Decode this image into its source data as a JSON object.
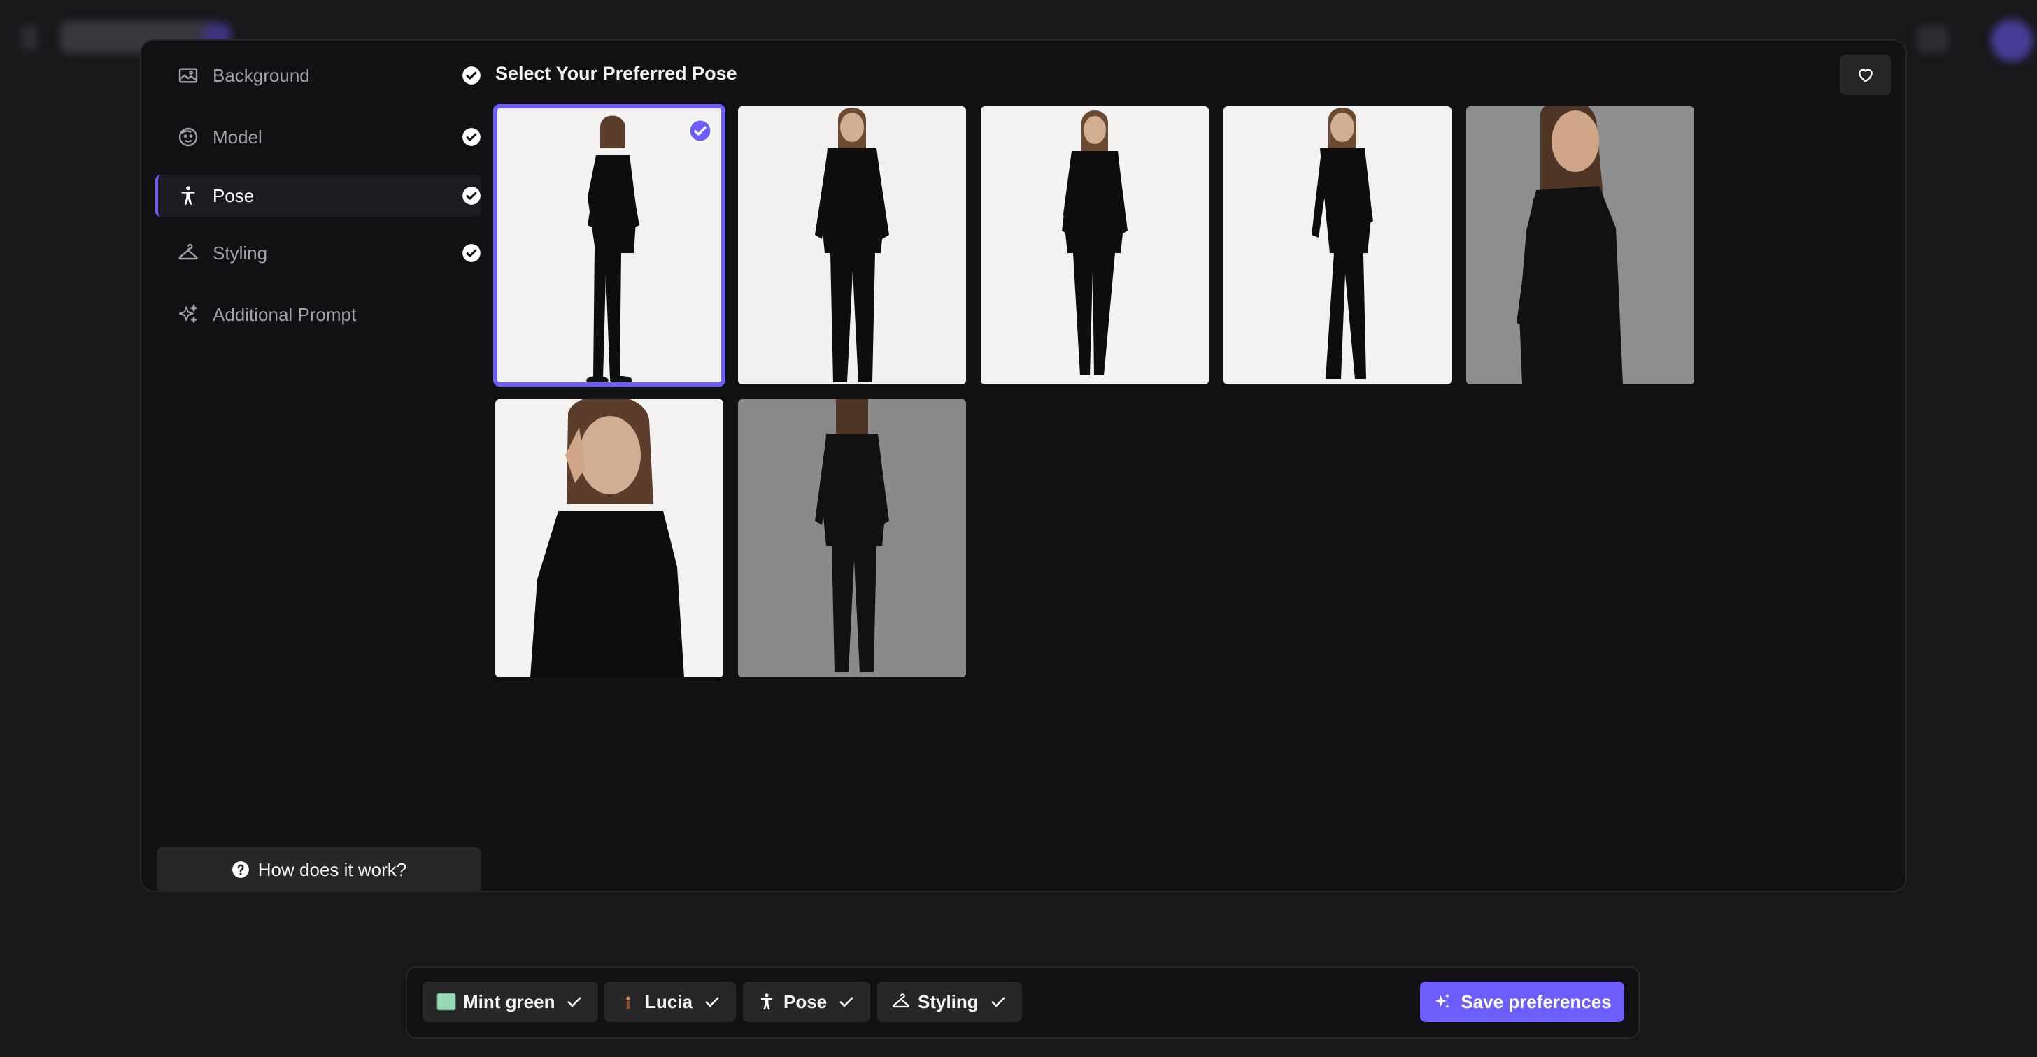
{
  "colors": {
    "accent": "#6d5dfc",
    "panel": "#111113",
    "chip": "#27272a",
    "mint": "#98d8b4"
  },
  "sidebar": {
    "items": [
      {
        "label": "Background",
        "icon": "image-frame-icon",
        "completed": true
      },
      {
        "label": "Model",
        "icon": "face-icon",
        "completed": true
      },
      {
        "label": "Pose",
        "icon": "person-pose-icon",
        "completed": true,
        "active": true
      },
      {
        "label": "Styling",
        "icon": "hanger-icon",
        "completed": true
      },
      {
        "label": "Additional Prompt",
        "icon": "sparkles-icon",
        "completed": false
      }
    ],
    "help_label": "How does it work?"
  },
  "main": {
    "title": "Select Your Preferred Pose",
    "poses": [
      {
        "id": 1,
        "bg": "light",
        "selected": true
      },
      {
        "id": 2,
        "bg": "light",
        "selected": false
      },
      {
        "id": 3,
        "bg": "light",
        "selected": false
      },
      {
        "id": 4,
        "bg": "light",
        "selected": false
      },
      {
        "id": 5,
        "bg": "gray",
        "selected": false
      },
      {
        "id": 6,
        "bg": "light",
        "selected": false
      },
      {
        "id": 7,
        "bg": "gray",
        "selected": false
      }
    ]
  },
  "bottom_bar": {
    "chips": [
      {
        "label": "Mint green",
        "icon": "color-swatch-icon"
      },
      {
        "label": "Lucia",
        "icon": "model-figure-icon"
      },
      {
        "label": "Pose",
        "icon": "person-pose-icon"
      },
      {
        "label": "Styling",
        "icon": "hanger-icon"
      }
    ],
    "save_label": "Save preferences"
  }
}
